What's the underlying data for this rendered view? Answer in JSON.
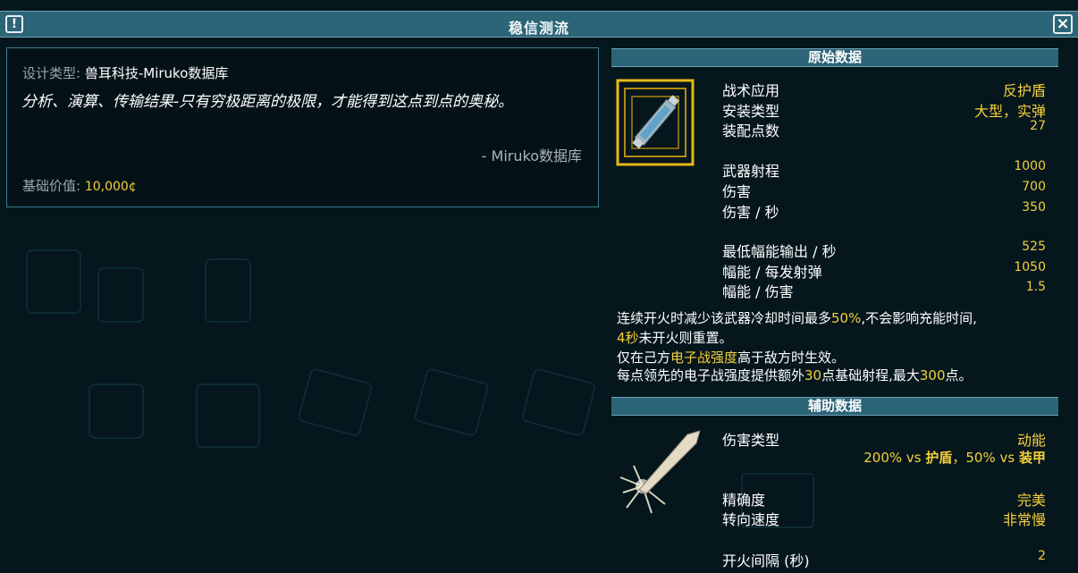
{
  "window": {
    "title": "稳信测流"
  },
  "description": {
    "design_type_label": "设计类型:",
    "design_type_value": "兽耳科技-Miruko数据库",
    "quote": "分析、演算、传输结果-只有穷极距离的极限，才能得到这点到点的奥秘。",
    "quote_source": "- Miruko数据库",
    "base_value_label": "基础价值:",
    "base_value": "10,000¢"
  },
  "primary": {
    "header": "原始数据",
    "tactical_use_label": "战术应用",
    "tactical_use": "反护盾",
    "mount_type_label": "安装类型",
    "mount_type": "大型，实弹",
    "op_label": "装配点数",
    "op": "27",
    "range_label": "武器射程",
    "range": "1000",
    "damage_label": "伤害",
    "damage": "700",
    "dps_label": "伤害 / 秒",
    "dps": "350",
    "min_flux_label": "最低幅能输出 / 秒",
    "min_flux": "525",
    "flux_shot_label": "幅能 / 每发射弹",
    "flux_shot": "1050",
    "flux_dmg_label": "幅能 / 伤害",
    "flux_dmg": "1.5"
  },
  "notes": {
    "l1a": "连续开火时减少该武器冷却时间最多",
    "l1b": "50%",
    "l1c": ",不会影响充能时间,",
    "l2a": "4秒",
    "l2b": "未开火则重置。",
    "l3a": "仅在己方",
    "l3b": "电子战强度",
    "l3c": "高于敌方时生效。",
    "l4a": "每点领先的电子战强度提供额外",
    "l4b": "30",
    "l4c": "点基础射程,最大",
    "l4d": "300",
    "l4e": "点。"
  },
  "ancillary": {
    "header": "辅助数据",
    "damage_type_label": "伤害类型",
    "damage_type": "动能",
    "vs_shield_pct": "200% vs",
    "vs_shield": "护盾",
    "vs_armor_pct": "，50% vs",
    "vs_armor": "装甲",
    "accuracy_label": "精确度",
    "accuracy": "完美",
    "turn_rate_label": "转向速度",
    "turn_rate": "非常慢",
    "refire_label": "开火间隔 (秒)",
    "refire": "2"
  },
  "colors": {
    "accent": "#f4d03a",
    "header_bg": "#2c6478",
    "bg": "#05161d"
  }
}
